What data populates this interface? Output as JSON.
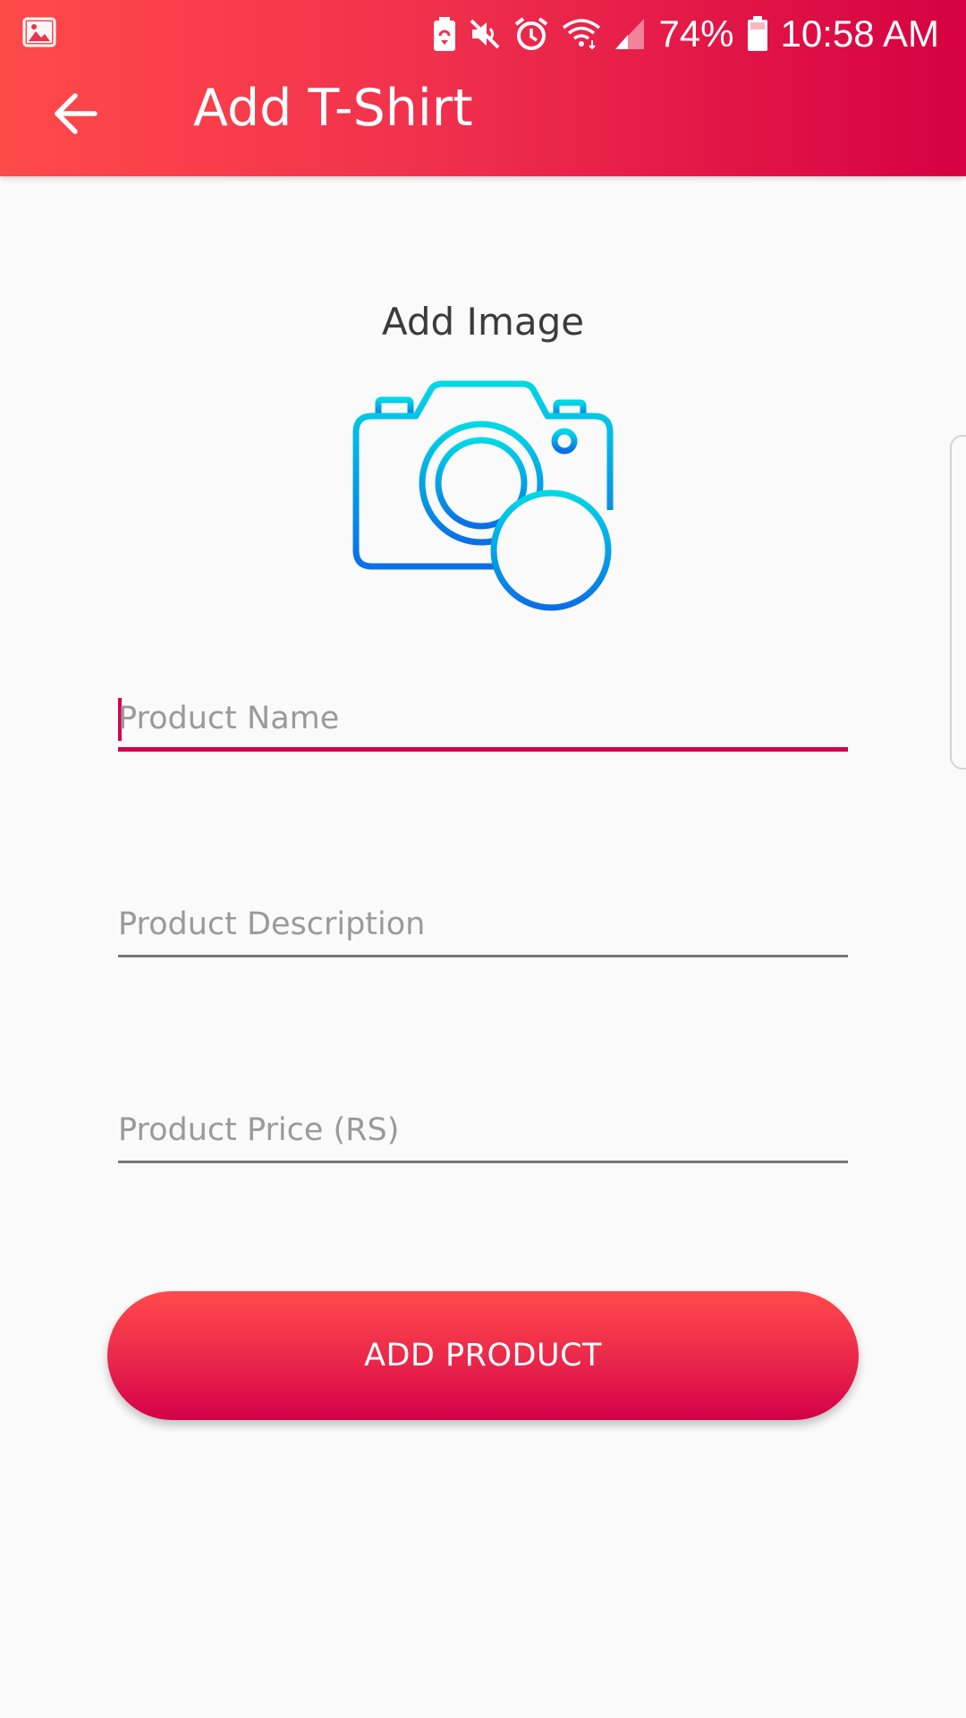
{
  "status_bar": {
    "battery_percent": "74%",
    "time": "10:58 AM",
    "icons": [
      "gallery-icon",
      "battery-saver-icon",
      "mute-icon",
      "alarm-icon",
      "wifi-icon",
      "signal-icon",
      "battery-icon"
    ]
  },
  "toolbar": {
    "title": "Add T-Shirt",
    "back_icon": "arrow-left-icon"
  },
  "image_section": {
    "label": "Add Image",
    "icon": "camera-add-icon"
  },
  "form": {
    "product_name": {
      "placeholder": "Product Name",
      "value": "",
      "focused": true
    },
    "product_description": {
      "placeholder": "Product Description",
      "value": ""
    },
    "product_price": {
      "placeholder": "Product Price (RS)",
      "value": ""
    }
  },
  "submit": {
    "label": "ADD PRODUCT"
  },
  "colors": {
    "accent": "#d6004c",
    "header_start": "#ff4a4a",
    "header_end": "#d60042",
    "camera_start": "#00d8e6",
    "camera_end": "#0a6fe6"
  }
}
